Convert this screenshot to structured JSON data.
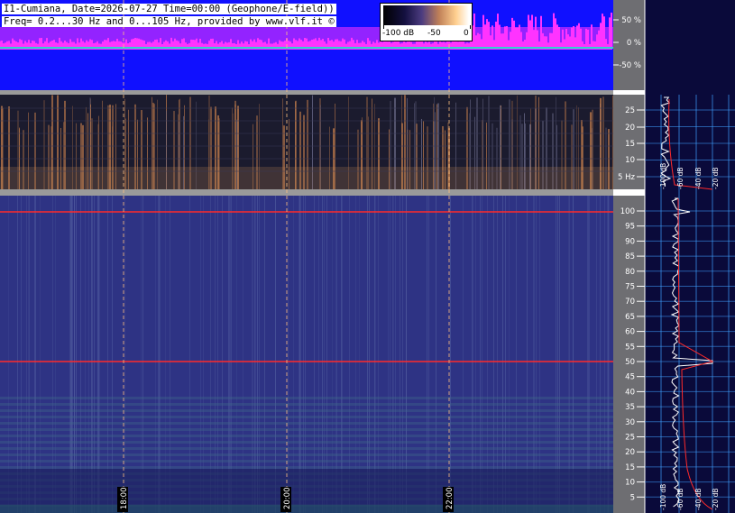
{
  "header": {
    "line1": "I1-Cumiana, Date=2026-07-27 Time=00:00 (Geophone/E-field))",
    "line2": "Freq= 0.2...30 Hz and 0...105 Hz, provided by www.vlf.it ©"
  },
  "color_scale": {
    "labels": [
      "-100 dB",
      "-50",
      "0"
    ]
  },
  "colors": {
    "background_dark": "#0a0a3a",
    "amplitude_bg": "#1010ff",
    "amplitude_trace": "#ff33ff",
    "lowfreq_bg": "#1b1b2e",
    "highfreq_bg": "#2e3384",
    "separator": "#9a9a9a",
    "mains_line": "#ff2a2a",
    "grid_line": "#3fa0ff",
    "marker_line": "#ffc080"
  },
  "amplitude_axis": {
    "labels": [
      "50 %",
      "0 %",
      "-50 %"
    ]
  },
  "lowfreq_axis": {
    "labels": [
      "25",
      "20",
      "15",
      "10",
      "5 Hz"
    ]
  },
  "highfreq_axis": {
    "labels": [
      "100",
      "95",
      "90",
      "85",
      "80",
      "75",
      "70",
      "65",
      "60",
      "55",
      "50",
      "45",
      "40",
      "35",
      "30",
      "25",
      "20",
      "15",
      "10",
      "5"
    ]
  },
  "time_markers": [
    "18:00",
    "20:00",
    "22:00"
  ],
  "spectrum_db_labels": [
    "-100 dB",
    "-60 dB",
    "-40 dB",
    "-20 dB"
  ],
  "spectrum_db_labels_low": [
    "-100 dB",
    "-60 dB",
    "-40 dB",
    "-20 dB"
  ]
}
